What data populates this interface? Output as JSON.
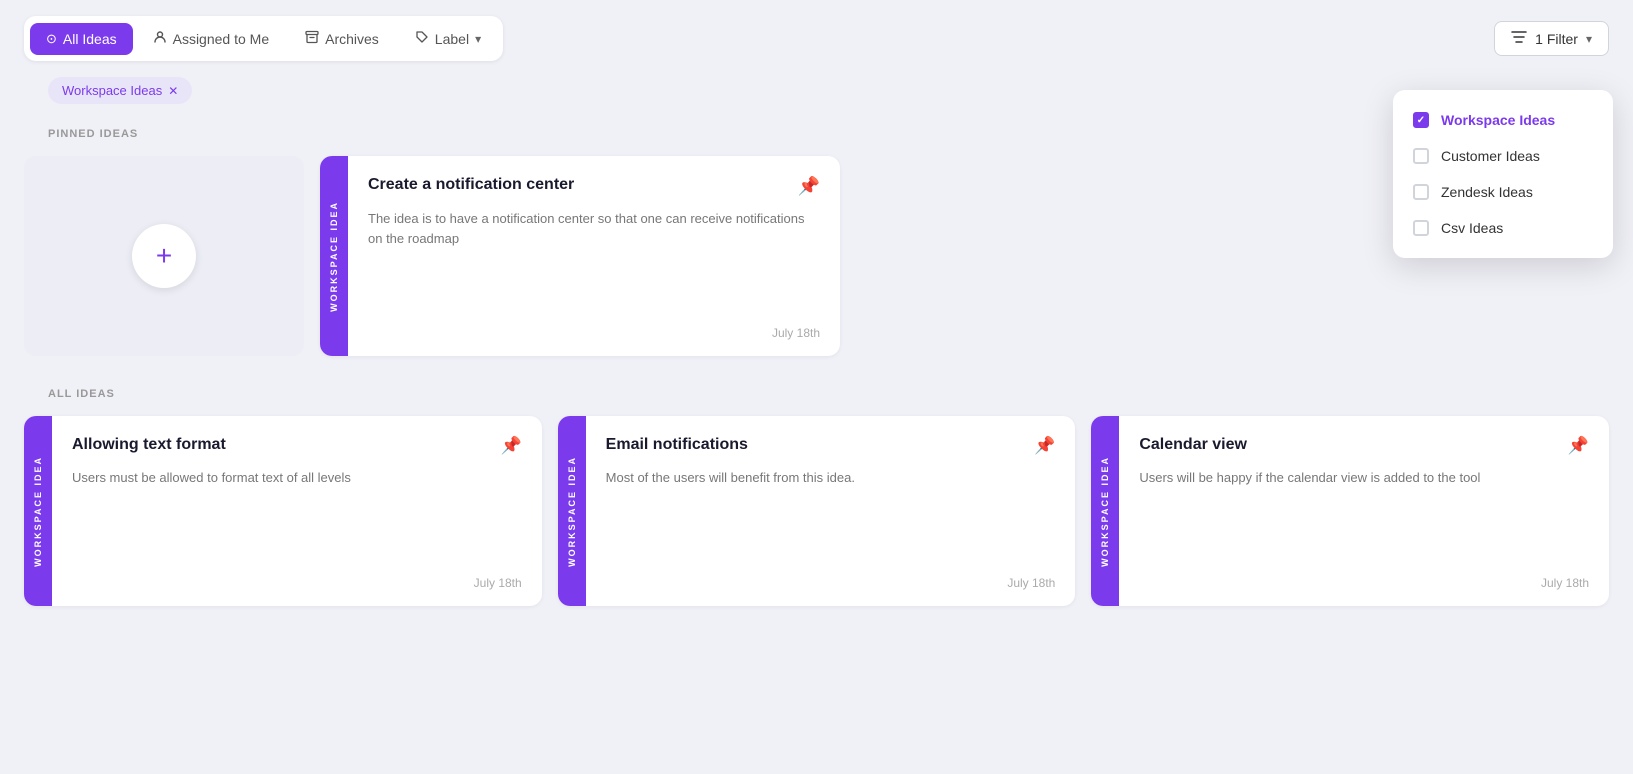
{
  "tabs": {
    "all_ideas": "All Ideas",
    "assigned_to_me": "Assigned to Me",
    "archives": "Archives",
    "label": "Label"
  },
  "filter_button": {
    "label": "1 Filter",
    "count": 1
  },
  "workspace_tag": {
    "label": "Workspace Ideas"
  },
  "sections": {
    "pinned": "PINNED IDEAS",
    "all": "ALL IDEAS"
  },
  "add_card": {
    "aria": "Add new idea"
  },
  "pinned_cards": [
    {
      "side_label": "WORKSPACE IDEA",
      "title": "Create a notification center",
      "description": "The idea is to have a notification center so that one can receive notifications on the roadmap",
      "date": "July 18th",
      "pinned": true
    }
  ],
  "all_cards": [
    {
      "side_label": "WORKSPACE IDEA",
      "title": "Allowing text format",
      "description": "Users must be allowed to format text of all levels",
      "date": "July 18th",
      "pinned": false
    },
    {
      "side_label": "WORKSPACE IDEA",
      "title": "Email notifications",
      "description": "Most of the users will  benefit from this idea.",
      "date": "July 18th",
      "pinned": false
    },
    {
      "side_label": "WORKSPACE IDEA",
      "title": "Calendar view",
      "description": "Users will be happy if the calendar view is added to the tool",
      "date": "July 18th",
      "pinned": false
    }
  ],
  "filter_dropdown": {
    "items": [
      {
        "label": "Workspace Ideas",
        "checked": true
      },
      {
        "label": "Customer Ideas",
        "checked": false
      },
      {
        "label": "Zendesk Ideas",
        "checked": false
      },
      {
        "label": "Csv Ideas",
        "checked": false
      }
    ]
  },
  "icons": {
    "all_ideas": "○",
    "assigned": "👤",
    "archives": "☰",
    "label": "◻",
    "pin_active": "📌",
    "pin_inactive": "📌",
    "filter_lines": "≡",
    "plus": "+",
    "chevron_down": "∨"
  },
  "colors": {
    "purple": "#7c3aed",
    "purple_light": "#e9e5f8",
    "bg": "#f0f0f7"
  }
}
